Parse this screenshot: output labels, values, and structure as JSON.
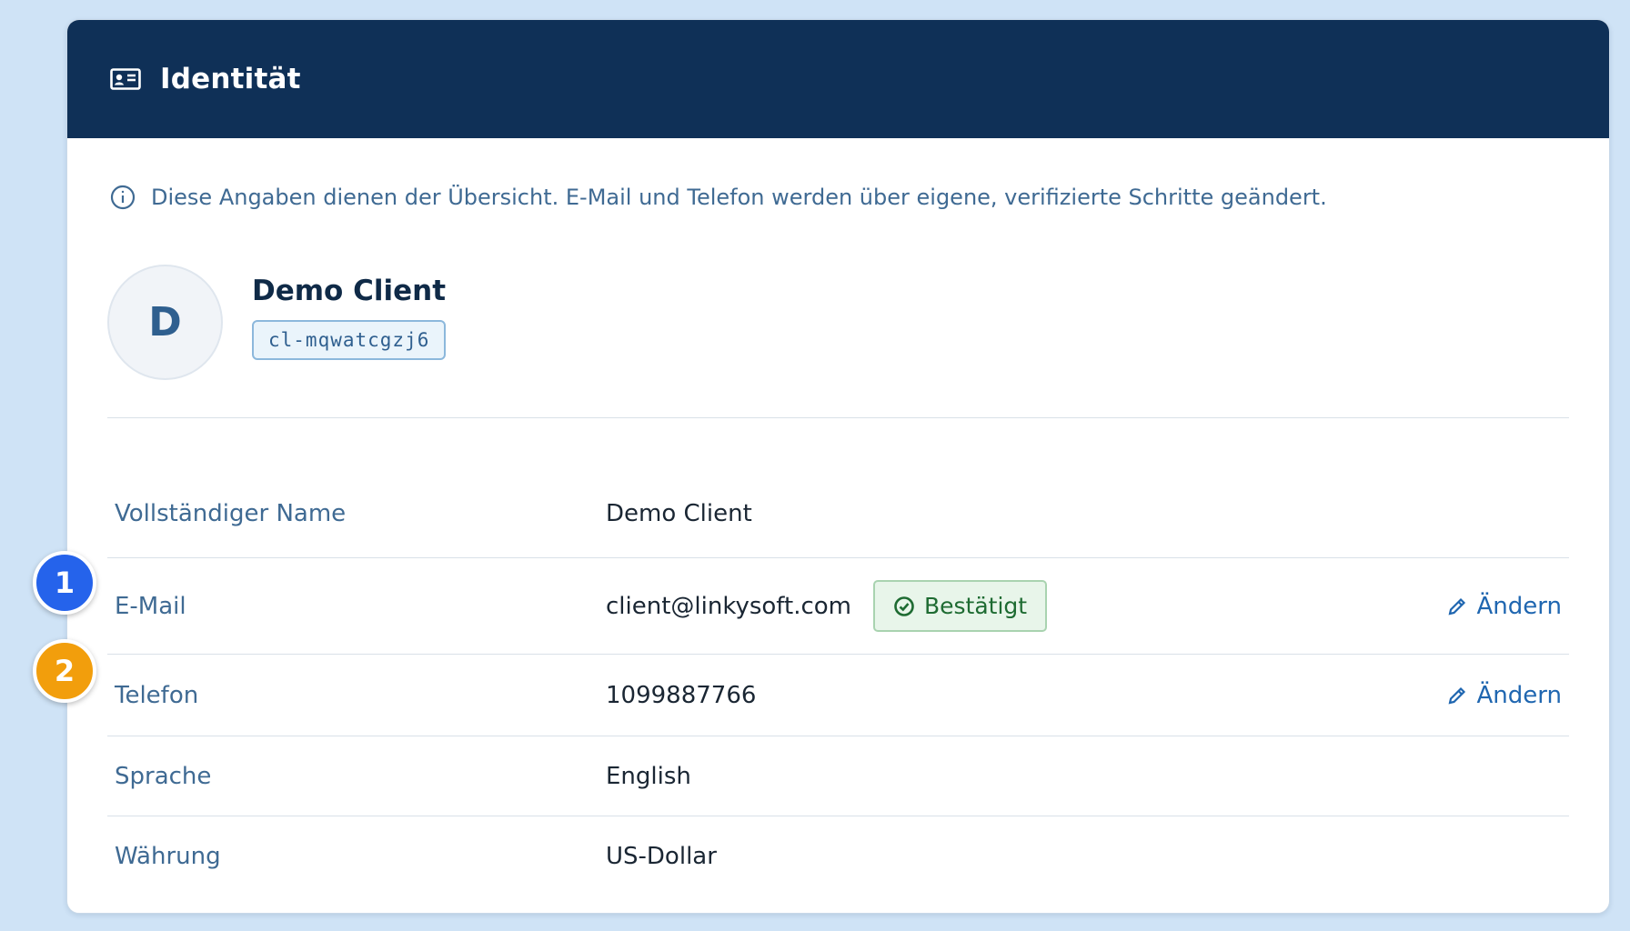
{
  "header": {
    "title": "Identität",
    "icon": "id-card-icon",
    "background": "#0f3057"
  },
  "info": {
    "icon": "info-circle-icon",
    "text": "Diese Angaben dienen der Übersicht. E-Mail und Telefon werden über eigene, verifizierte Schritte geändert."
  },
  "profile": {
    "avatar_letter": "D",
    "name": "Demo Client",
    "client_id": "cl-mqwatcgzj6"
  },
  "fields": {
    "name": {
      "label": "Vollständiger Name",
      "value": "Demo Client"
    },
    "email": {
      "label": "E-Mail",
      "value": "client@linkysoft.com",
      "badge": "Bestätigt",
      "badge_icon": "check-circle-icon",
      "edit_label": "Ändern",
      "edit_icon": "pencil-icon"
    },
    "phone": {
      "label": "Telefon",
      "value": "1099887766",
      "edit_label": "Ändern",
      "edit_icon": "pencil-icon"
    },
    "language": {
      "label": "Sprache",
      "value": "English"
    },
    "currency": {
      "label": "Währung",
      "value": "US-Dollar"
    }
  },
  "markers": [
    {
      "number": "1",
      "color": "#2563eb"
    },
    {
      "number": "2",
      "color": "#f29e0c"
    }
  ],
  "colors": {
    "page_background": "#cfe3f6",
    "label": "#3f6a93",
    "link": "#1f66b0",
    "success": "#1e6b32"
  }
}
